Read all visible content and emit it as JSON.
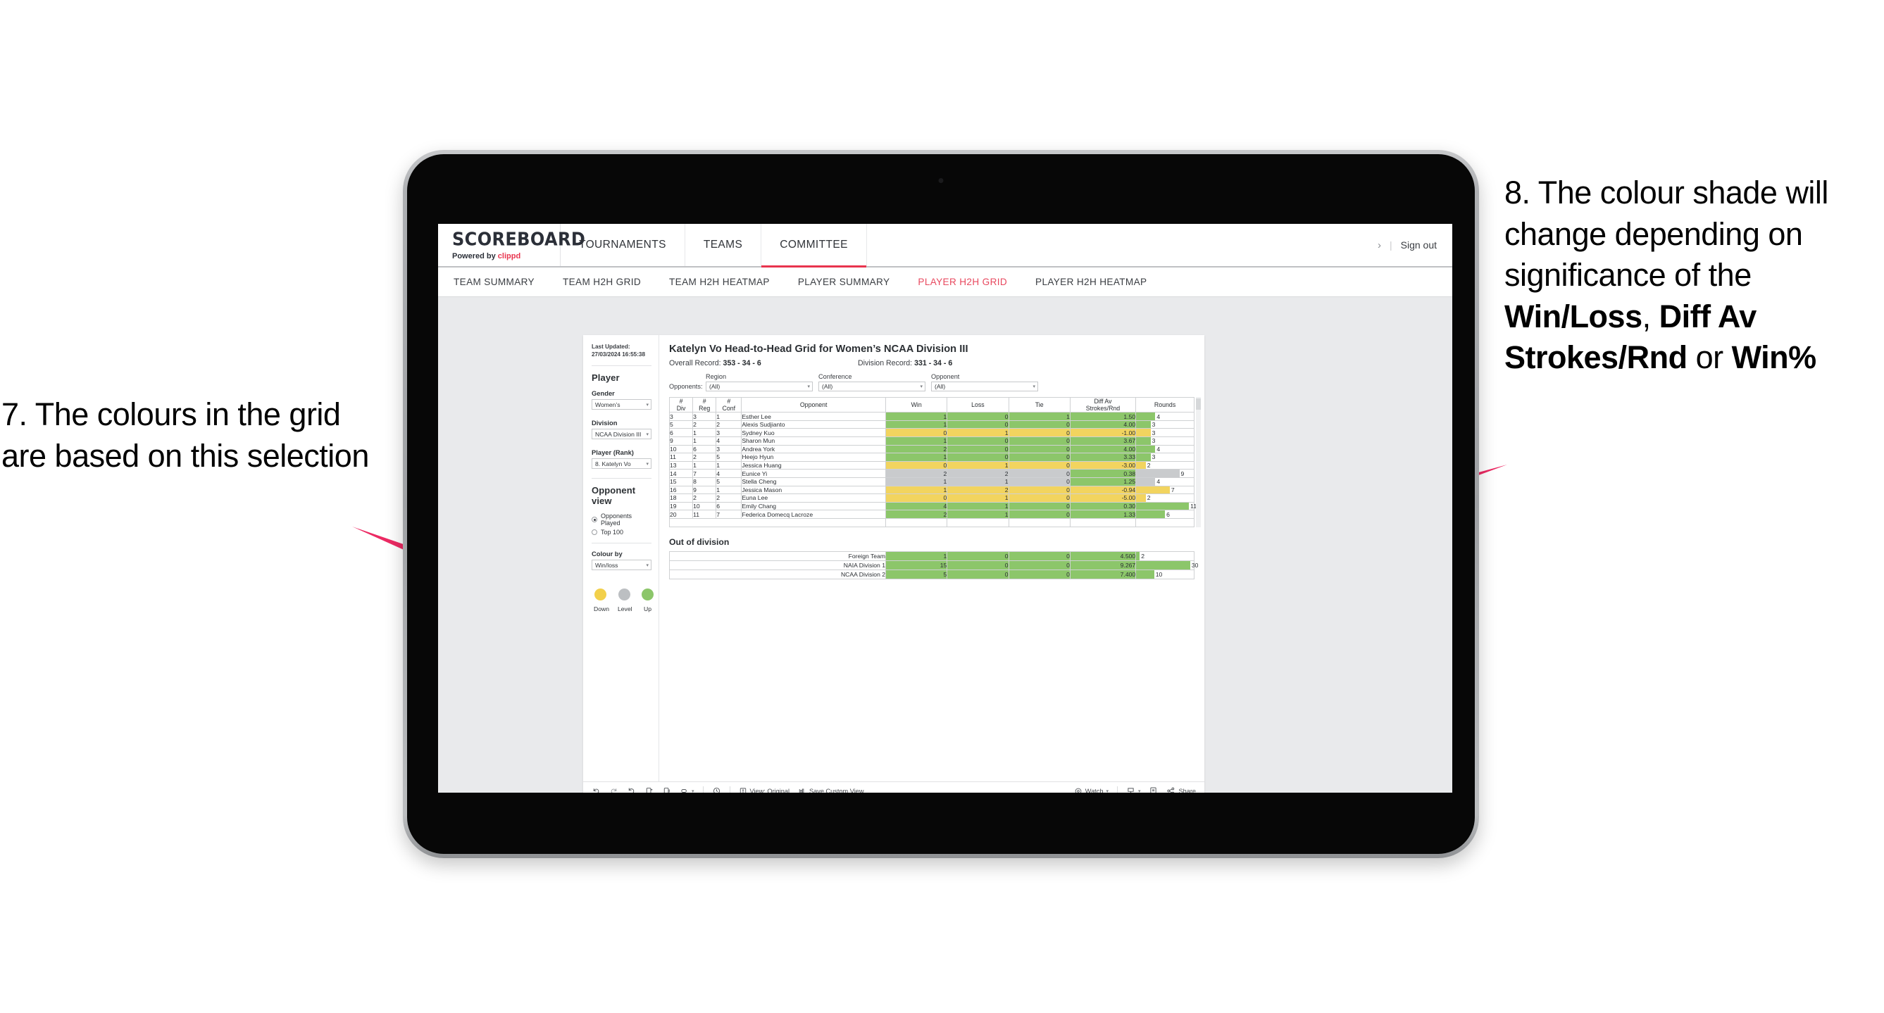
{
  "annotations": {
    "left": "7. The colours in the grid are based on this selection",
    "right_pre": "8. The colour shade will change depending on significance of the ",
    "right_b1": "Win/Loss",
    "right_mid1": ", ",
    "right_b2": "Diff Av Strokes/Rnd",
    "right_mid2": " or ",
    "right_b3": "Win%",
    "arrow_color": "#ec2a63"
  },
  "header": {
    "brand_title": "SCOREBOARD",
    "brand_sub_prefix": "Powered by ",
    "brand_sub_name": "clippd",
    "nav": [
      {
        "label": "TOURNAMENTS",
        "active": false
      },
      {
        "label": "TEAMS",
        "active": false
      },
      {
        "label": "COMMITTEE",
        "active": true
      }
    ],
    "chevron": "›",
    "divider": "|",
    "sign_out": "Sign out"
  },
  "subnav": [
    {
      "label": "TEAM SUMMARY",
      "active": false
    },
    {
      "label": "TEAM H2H GRID",
      "active": false
    },
    {
      "label": "TEAM H2H HEATMAP",
      "active": false
    },
    {
      "label": "PLAYER SUMMARY",
      "active": false
    },
    {
      "label": "PLAYER H2H GRID",
      "active": true
    },
    {
      "label": "PLAYER H2H HEATMAP",
      "active": false
    }
  ],
  "panel": {
    "last_updated": "Last Updated: 27/03/2024 16:55:38",
    "section_player": "Player",
    "gender_label": "Gender",
    "gender_value": "Women’s",
    "division_label": "Division",
    "division_value": "NCAA Division III",
    "player_label": "Player (Rank)",
    "player_value": "8. Katelyn Vo",
    "opponent_view_label": "Opponent view",
    "opponent_options": [
      {
        "label": "Opponents Played",
        "selected": true
      },
      {
        "label": "Top 100",
        "selected": false
      }
    ],
    "colour_by_label": "Colour by",
    "colour_by_value": "Win/loss",
    "legend": [
      {
        "label": "Down",
        "color": "#f2d04b"
      },
      {
        "label": "Level",
        "color": "#bcbfc2"
      },
      {
        "label": "Up",
        "color": "#8cc66a"
      }
    ]
  },
  "main": {
    "title": "Katelyn Vo Head-to-Head Grid for Women’s NCAA Division III",
    "overall_record_label": "Overall Record: ",
    "overall_record_value": "353 - 34 - 6",
    "division_record_label": "Division Record: ",
    "division_record_value": "331 - 34 - 6",
    "opponents_label": "Opponents:",
    "filters": [
      {
        "label": "Region",
        "value": "(All)"
      },
      {
        "label": "Conference",
        "value": "(All)"
      },
      {
        "label": "Opponent",
        "value": "(All)"
      }
    ]
  },
  "chart_data": {
    "type": "table",
    "title": "Katelyn Vo Head-to-Head Grid for Women’s NCAA Division III",
    "columns": [
      "# Div",
      "# Reg",
      "# Conf",
      "Opponent",
      "Win",
      "Loss",
      "Tie",
      "Diff Av Strokes/Rnd",
      "Rounds"
    ],
    "column_header_lines": [
      [
        "#",
        "Div"
      ],
      [
        "#",
        "Reg"
      ],
      [
        "#",
        "Conf"
      ],
      [
        "Opponent"
      ],
      [
        "Win"
      ],
      [
        "Loss"
      ],
      [
        "Tie"
      ],
      [
        "Diff Av",
        "Strokes/Rnd"
      ],
      [
        "Rounds"
      ]
    ],
    "colour_scheme": {
      "up": "#8cc66a",
      "level": "#c9cbcd",
      "down": "#f2d45f",
      "neutral_white": "#ffffff"
    },
    "rounds_max": 12,
    "rows": [
      {
        "div": "3",
        "reg": "3",
        "conf": "1",
        "opponent": "Esther Lee",
        "win": "1",
        "loss": "0",
        "tie": "1",
        "diff": "1.50",
        "rounds": "4",
        "state": "up"
      },
      {
        "div": "5",
        "reg": "2",
        "conf": "2",
        "opponent": "Alexis Sudjianto",
        "win": "1",
        "loss": "0",
        "tie": "0",
        "diff": "4.00",
        "rounds": "3",
        "state": "up"
      },
      {
        "div": "6",
        "reg": "1",
        "conf": "3",
        "opponent": "Sydney Kuo",
        "win": "0",
        "loss": "1",
        "tie": "0",
        "diff": "-1.00",
        "rounds": "3",
        "state": "down"
      },
      {
        "div": "9",
        "reg": "1",
        "conf": "4",
        "opponent": "Sharon Mun",
        "win": "1",
        "loss": "0",
        "tie": "0",
        "diff": "3.67",
        "rounds": "3",
        "state": "up"
      },
      {
        "div": "10",
        "reg": "6",
        "conf": "3",
        "opponent": "Andrea York",
        "win": "2",
        "loss": "0",
        "tie": "0",
        "diff": "4.00",
        "rounds": "4",
        "state": "up"
      },
      {
        "div": "11",
        "reg": "2",
        "conf": "5",
        "opponent": "Heejo Hyun",
        "win": "1",
        "loss": "0",
        "tie": "0",
        "diff": "3.33",
        "rounds": "3",
        "state": "up"
      },
      {
        "div": "13",
        "reg": "1",
        "conf": "1",
        "opponent": "Jessica Huang",
        "win": "0",
        "loss": "1",
        "tie": "0",
        "diff": "-3.00",
        "rounds": "2",
        "state": "down"
      },
      {
        "div": "14",
        "reg": "7",
        "conf": "4",
        "opponent": "Eunice Yi",
        "win": "2",
        "loss": "2",
        "tie": "0",
        "diff": "0.38",
        "rounds": "9",
        "state": "level",
        "diff_state": "up"
      },
      {
        "div": "15",
        "reg": "8",
        "conf": "5",
        "opponent": "Stella Cheng",
        "win": "1",
        "loss": "1",
        "tie": "0",
        "diff": "1.25",
        "rounds": "4",
        "state": "level",
        "diff_state": "up"
      },
      {
        "div": "16",
        "reg": "9",
        "conf": "1",
        "opponent": "Jessica Mason",
        "win": "1",
        "loss": "2",
        "tie": "0",
        "diff": "-0.94",
        "rounds": "7",
        "state": "down"
      },
      {
        "div": "18",
        "reg": "2",
        "conf": "2",
        "opponent": "Euna Lee",
        "win": "0",
        "loss": "1",
        "tie": "0",
        "diff": "-5.00",
        "rounds": "2",
        "state": "down"
      },
      {
        "div": "19",
        "reg": "10",
        "conf": "6",
        "opponent": "Emily Chang",
        "win": "4",
        "loss": "1",
        "tie": "0",
        "diff": "0.30",
        "rounds": "11",
        "state": "up"
      },
      {
        "div": "20",
        "reg": "11",
        "conf": "7",
        "opponent": "Federica Domecq Lacroze",
        "win": "2",
        "loss": "1",
        "tie": "0",
        "diff": "1.33",
        "rounds": "6",
        "state": "up"
      }
    ],
    "out_of_division_title": "Out of division",
    "out_of_division_rounds_max": 32,
    "out_of_division": [
      {
        "name": "Foreign Team",
        "win": "1",
        "loss": "0",
        "tie": "0",
        "diff": "4.500",
        "rounds": "2",
        "state": "up"
      },
      {
        "name": "NAIA Division 1",
        "win": "15",
        "loss": "0",
        "tie": "0",
        "diff": "9.267",
        "rounds": "30",
        "state": "up"
      },
      {
        "name": "NCAA Division 2",
        "win": "5",
        "loss": "0",
        "tie": "0",
        "diff": "7.400",
        "rounds": "10",
        "state": "up"
      }
    ]
  },
  "toolbar": {
    "view_original": "View: Original",
    "save_custom_view": "Save Custom View",
    "watch": "Watch",
    "share": "Share",
    "caret": "▾"
  }
}
